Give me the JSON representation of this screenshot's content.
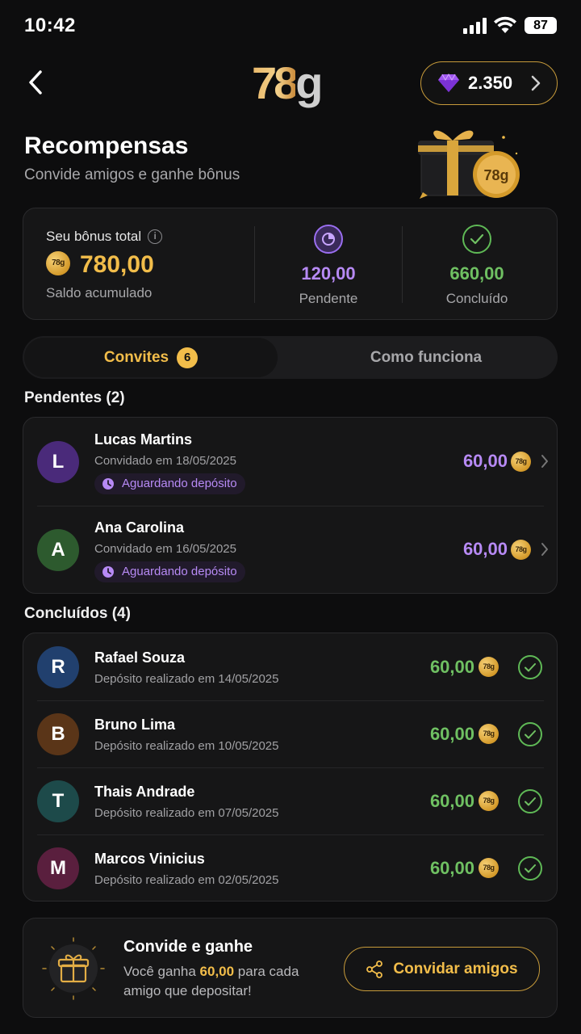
{
  "status_bar": {
    "time": "10:42",
    "battery": "87"
  },
  "header": {
    "logo_a": "78",
    "logo_b": "g",
    "gems_value": "2.350"
  },
  "page": {
    "title": "Recompensas",
    "subtitle": "Convide amigos e ganhe bônus"
  },
  "summary": {
    "label": "Seu bônus total",
    "total": "780,00",
    "total_note": "Saldo acumulado",
    "pending_value": "120,00",
    "pending_label": "Pendente",
    "done_value": "660,00",
    "done_label": "Concluído"
  },
  "tabs": {
    "active_label": "Convites",
    "active_badge": "6",
    "other_label": "Como funciona"
  },
  "pending_section": {
    "title": "Pendentes (2)",
    "items": [
      {
        "initial": "L",
        "name": "Lucas Martins",
        "date": "Convidado em 18/05/2025",
        "status": "Aguardando depósito",
        "amount": "60,00",
        "avatar_color": "#4a2a7a"
      },
      {
        "initial": "A",
        "name": "Ana Carolina",
        "date": "Convidado em 16/05/2025",
        "status": "Aguardando depósito",
        "amount": "60,00",
        "avatar_color": "#2d5a2e"
      }
    ]
  },
  "done_section": {
    "title": "Concluídos (4)",
    "items": [
      {
        "initial": "R",
        "name": "Rafael Souza",
        "date": "Depósito realizado em 14/05/2025",
        "amount": "60,00",
        "avatar_color": "#21406e"
      },
      {
        "initial": "B",
        "name": "Bruno Lima",
        "date": "Depósito realizado em 10/05/2025",
        "amount": "60,00",
        "avatar_color": "#5a3518"
      },
      {
        "initial": "T",
        "name": "Thais Andrade",
        "date": "Depósito realizado em 07/05/2025",
        "amount": "60,00",
        "avatar_color": "#1d4a4a"
      },
      {
        "initial": "M",
        "name": "Marcos Vinicius",
        "date": "Depósito realizado em 02/05/2025",
        "amount": "60,00",
        "avatar_color": "#5a1f3e"
      }
    ]
  },
  "invite": {
    "title": "Convide e ganhe",
    "text_a": "Você ganha ",
    "text_hl": "60,00",
    "text_b": " para cada amigo que depositar!",
    "button": "Convidar amigos"
  },
  "coin_label": "78g",
  "colors": {
    "accent": "#f2bd4a",
    "pending": "#b78af5",
    "done": "#6fc062"
  }
}
